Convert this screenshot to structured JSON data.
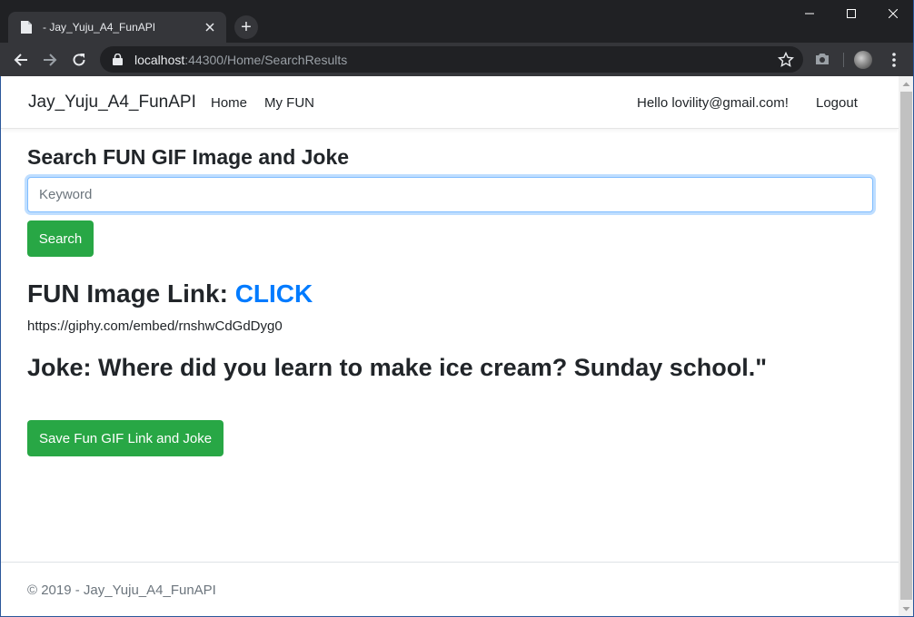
{
  "browser": {
    "tab_title": "- Jay_Yuju_A4_FunAPI",
    "new_tab_symbol": "+",
    "url_host": "localhost",
    "url_rest": ":44300/Home/SearchResults"
  },
  "navbar": {
    "brand": "Jay_Yuju_A4_FunAPI",
    "home": "Home",
    "my_fun": "My FUN",
    "greeting": "Hello lovility@gmail.com!",
    "logout": "Logout"
  },
  "search": {
    "heading": "Search FUN GIF Image and Joke",
    "placeholder": "Keyword",
    "button_label": "Search"
  },
  "result": {
    "image_label": "FUN Image Link: ",
    "image_link_text": "CLICK",
    "gif_url": "https://giphy.com/embed/rnshwCdGdDyg0",
    "joke": "Joke: Where did you learn to make ice cream? Sunday school.\"",
    "save_button": "Save Fun GIF Link and Joke"
  },
  "footer": {
    "text": "© 2019 - Jay_Yuju_A4_FunAPI"
  },
  "colors": {
    "accent_green": "#28a745",
    "link_blue": "#007bff",
    "chrome_dark": "#202124",
    "chrome_toolbar": "#35363a"
  },
  "icons": [
    "page-favicon-icon",
    "close-icon",
    "back-arrow-icon",
    "forward-arrow-icon",
    "reload-icon",
    "lock-icon",
    "star-icon",
    "camera-icon",
    "menu-icon"
  ]
}
